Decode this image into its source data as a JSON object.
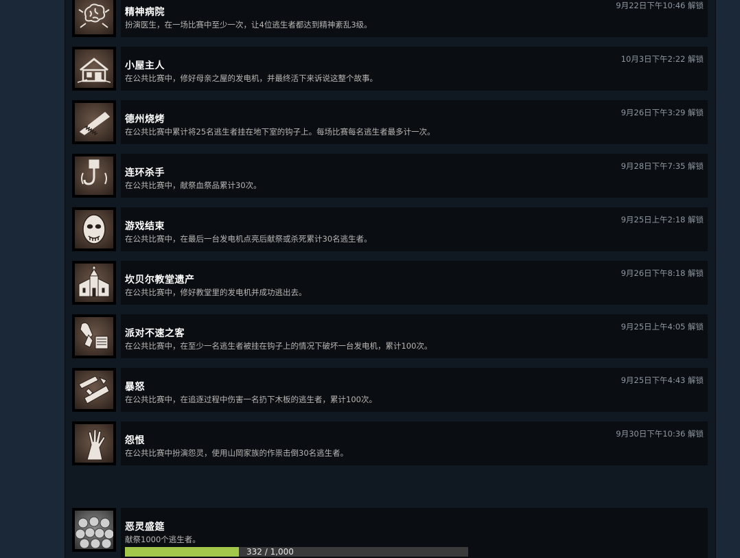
{
  "achievements": [
    {
      "title": "精神病院",
      "desc": "扮演医生，在一场比赛中至少一次，让4位逃生者都达到精神紊乱3级。",
      "date": "9月22日下午10:46 解锁",
      "icon": "brain-icon"
    },
    {
      "title": "小屋主人",
      "desc": "在公共比赛中，修好母亲之屋的发电机，并最终活下来诉说这整个故事。",
      "date": "10月3日下午2:22 解锁",
      "icon": "house-icon"
    },
    {
      "title": "德州烧烤",
      "desc": "在公共比赛中累计将25名逃生者挂在地下室的钩子上。每场比赛每名逃生者最多计一次。",
      "date": "9月26日下午3:29 解锁",
      "icon": "chainsaw-icon"
    },
    {
      "title": "连环杀手",
      "desc": "在公共比赛中，献祭血祭品累计30次。",
      "date": "9月28日下午7:35 解锁",
      "icon": "hook-icon"
    },
    {
      "title": "游戏结束",
      "desc": "在公共比赛中，在最后一台发电机点亮后献祭或杀死累计30名逃生者。",
      "date": "9月25日上午2:18 解锁",
      "icon": "mask-icon"
    },
    {
      "title": "坎贝尔教堂遗产",
      "desc": "在公共比赛中，修好教堂里的发电机并成功逃出去。",
      "date": "9月26日下午8:18 解锁",
      "icon": "chapel-icon"
    },
    {
      "title": "派对不速之客",
      "desc": "在公共比赛中，在至少一名逃生者被挂在钩子上的情况下破坏一台发电机，累计100次。",
      "date": "9月25日上午4:05 解锁",
      "icon": "generator-icon"
    },
    {
      "title": "暴怒",
      "desc": "在公共比赛中，在追逐过程中伤害一名扔下木板的逃生者，累计100次。",
      "date": "9月25日下午4:43 解锁",
      "icon": "plank-icon"
    },
    {
      "title": "怨恨",
      "desc": "在公共比赛中扮演怨灵，使用山岡家族的作祟击倒30名逃生者。",
      "date": "9月30日下午10:36 解锁",
      "icon": "hand-icon"
    }
  ],
  "locked_achievement": {
    "title": "恶灵盛筵",
    "desc": "献祭1000个逃生者。",
    "icon": "skulls-icon",
    "progress_text": "332 / 1,000",
    "progress_fraction": 0.332
  }
}
